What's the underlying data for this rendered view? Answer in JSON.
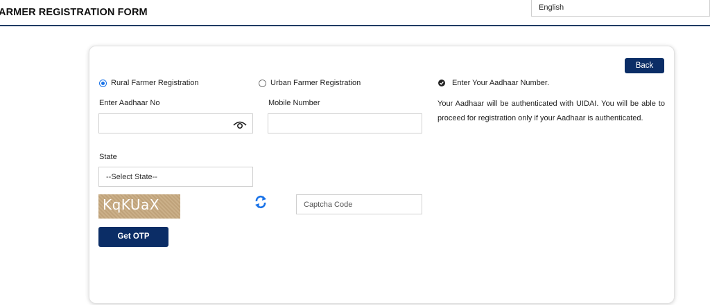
{
  "header": {
    "title": "ARMER REGISTRATION FORM",
    "language": "English"
  },
  "form": {
    "back_label": "Back",
    "radio_rural_label": "Rural Farmer Registration",
    "radio_urban_label": "Urban Farmer Registration",
    "selected_radio": "rural",
    "aadhaar_label": "Enter Aadhaar No",
    "aadhaar_value": "",
    "mobile_label": "Mobile Number",
    "mobile_value": "",
    "state_label": "State",
    "state_selected": "--Select State--",
    "captcha_text": "KqKUaX",
    "captcha_placeholder": "Captcha Code",
    "otp_label": "Get OTP"
  },
  "info": {
    "heading": "Enter Your Aadhaar Number.",
    "text": "Your Aadhaar will be authenticated with UIDAI. You will be able to proceed for registration only if your Aadhaar is authenticated."
  },
  "colors": {
    "primary_button": "#0b2d66",
    "radio_accent": "#1a73e8",
    "captcha_bg": "#c7a97f",
    "refresh_icon": "#1a73e8"
  }
}
